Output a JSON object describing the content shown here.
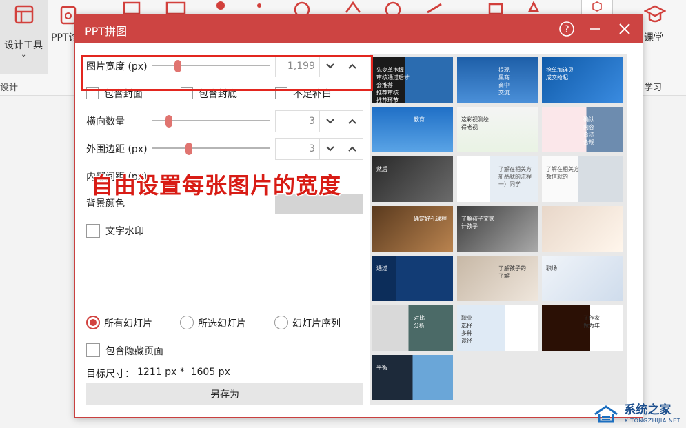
{
  "ribbon": {
    "design_tools": "设计工具",
    "ppt_item": "PPT诊",
    "classroom": "课堂",
    "group_left": "设计",
    "group_right": "学习"
  },
  "watermark": {
    "main": "系统之家",
    "sub": "XITONGZHIJIA.NET"
  },
  "dialog": {
    "title": "PPT拼图",
    "width_label": "图片宽度 (px)",
    "width_value": "1,199",
    "width_fraction": 0.2,
    "include_cover": "包含封面",
    "include_back": "包含封底",
    "fill_blank": "不足补白",
    "cols_label": "横向数量",
    "cols_value": "3",
    "cols_fraction": 0.12,
    "margin_label": "外围边距 (px)",
    "margin_value": "3",
    "margin_fraction": 0.3,
    "inner_label": "内部间距 (px)",
    "bg_label": "背景颜色",
    "text_watermark": "文字水印",
    "all_slides": "所有幻灯片",
    "selected_slides": "所选幻灯片",
    "slide_sequence": "幻灯片序列",
    "include_hidden": "包含隐藏页面",
    "target_size_label": "目标尺寸：",
    "target_size_value": "1211 px *  1605 px",
    "save_as": "另存为"
  },
  "overlay_caption": "自由设置每张图片的宽度",
  "preview": {
    "slides": [
      {
        "texts": [
          "先变革抱握",
          "审核通过后才",
          "会推荐",
          "推荐审核",
          "推荐环节"
        ]
      },
      {
        "texts": [
          "提现",
          "黑商",
          "商中",
          "交流"
        ]
      },
      {
        "texts": [
          "抢单加连贝",
          "成交抢起"
        ]
      },
      {
        "texts": [
          "教育"
        ]
      },
      {
        "texts": [
          "这彩视测绘",
          "得老视"
        ]
      },
      {
        "texts": [
          "确认",
          "内容",
          "合法",
          "合规"
        ]
      },
      {
        "texts": [
          "然后"
        ]
      },
      {
        "texts": [
          "了解在相关方",
          "新品就的流程",
          "一）同学"
        ]
      },
      {
        "texts": [
          "了解在相关方",
          "数信就的"
        ]
      },
      {
        "texts": [
          "确定好孔课程"
        ]
      },
      {
        "texts": [
          "了解孩子文家",
          "计孩子"
        ]
      },
      {
        "texts": []
      },
      {
        "texts": [
          "通过"
        ]
      },
      {
        "texts": [
          "了解孩子的",
          "了解"
        ]
      },
      {
        "texts": [
          "职场"
        ]
      },
      {
        "texts": [
          "对比",
          "分析"
        ]
      },
      {
        "texts": [
          "职业",
          "选择",
          "多种",
          "途径"
        ]
      },
      {
        "texts": [
          "了作家",
          "做为年"
        ]
      },
      {
        "texts": [
          "平衡"
        ]
      }
    ]
  }
}
